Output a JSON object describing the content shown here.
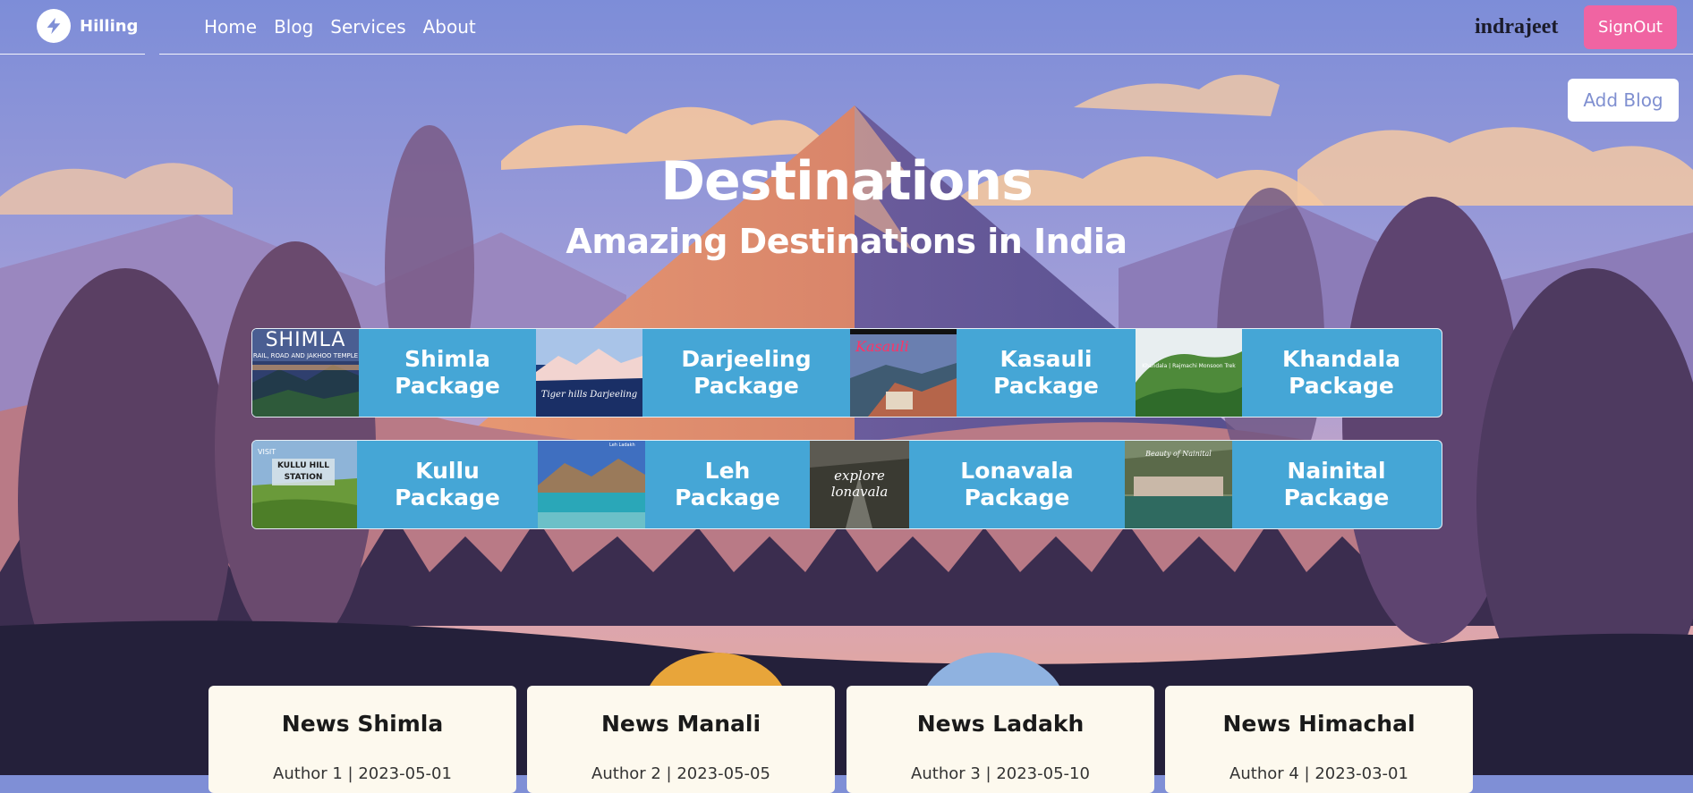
{
  "colors": {
    "sky": "#7f8fd6",
    "accent_pink": "#f064a2",
    "package_blue": "#45a6d6",
    "card_bg": "#fdf9ee"
  },
  "navbar": {
    "brand_icon": "bolt-logo-icon",
    "brand_name": "Hilling",
    "links": [
      "Home",
      "Blog",
      "Services",
      "About"
    ],
    "username": "indrajeet",
    "signout_label": "SignOut"
  },
  "actions": {
    "add_blog_label": "Add Blog"
  },
  "hero": {
    "title": "Destinations",
    "subtitle": "Amazing Destinations in India"
  },
  "packages": {
    "row1": [
      {
        "name": "Shimla",
        "label_line1": "Shimla",
        "label_line2": "Package",
        "thumb_text": "SHIMLA",
        "thumb_subtext": "RAIL, ROAD AND JAKHOO TEMPLE"
      },
      {
        "name": "Darjeeling",
        "label_line1": "Darjeeling",
        "label_line2": "Package",
        "thumb_text": "Tiger hills Darjeeling"
      },
      {
        "name": "Kasauli",
        "label_line1": "Kasauli",
        "label_line2": "Package",
        "thumb_text": "Kasauli"
      },
      {
        "name": "Khandala",
        "label_line1": "Khandala",
        "label_line2": "Package",
        "thumb_text": "Khandala | Rajmachi Monsoon Trek"
      }
    ],
    "row2": [
      {
        "name": "Kullu",
        "label_line1": "Kullu",
        "label_line2": "Package",
        "thumb_text": "KULLU HILL STATION",
        "thumb_subtext": "VISIT"
      },
      {
        "name": "Leh",
        "label_line1": "Leh",
        "label_line2": "Package",
        "thumb_text": "Leh Ladakh"
      },
      {
        "name": "Lonavala",
        "label_line1": "Lonavala",
        "label_line2": "Package",
        "thumb_text": "explore lonavala"
      },
      {
        "name": "Nainital",
        "label_line1": "Nainital",
        "label_line2": "Package",
        "thumb_text": "Beauty of Nainital"
      }
    ]
  },
  "news": [
    {
      "title": "News Shimla",
      "meta": "Author 1 | 2023-05-01"
    },
    {
      "title": "News Manali",
      "meta": "Author 2 | 2023-05-05"
    },
    {
      "title": "News Ladakh",
      "meta": "Author 3 | 2023-05-10"
    },
    {
      "title": "News Himachal",
      "meta": "Author 4 | 2023-03-01"
    }
  ]
}
